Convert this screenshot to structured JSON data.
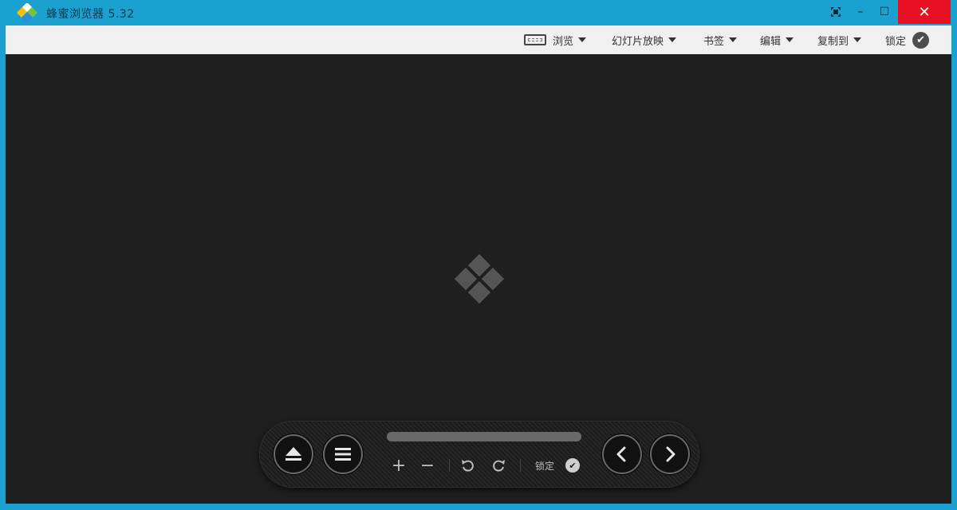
{
  "app": {
    "title": "蜂蜜浏览器 5.32",
    "accent_color": "#1ba1d0"
  },
  "window_controls": {
    "fullscreen_icon": "fullscreen-icon",
    "minimize_icon": "minimize-icon",
    "maximize_icon": "maximize-icon",
    "close_icon": "close-icon",
    "minimize_glyph": "–",
    "maximize_glyph": "☐",
    "close_glyph": "✕"
  },
  "menu": {
    "items": [
      {
        "label": "浏览",
        "has_dropdown": true,
        "icon": "browse-frame-icon"
      },
      {
        "label": "幻灯片放映",
        "has_dropdown": true
      },
      {
        "label": "书签",
        "has_dropdown": true
      },
      {
        "label": "编辑",
        "has_dropdown": true
      },
      {
        "label": "复制到",
        "has_dropdown": true
      },
      {
        "label": "锁定",
        "has_dropdown": false,
        "icon": "check-circle-icon"
      }
    ]
  },
  "viewer": {
    "background": "#1f1f1f",
    "placeholder_icon": "app-logo-placeholder-icon"
  },
  "controlbar": {
    "eject_icon": "eject-icon",
    "menu_icon": "list-menu-icon",
    "zoom_in_glyph": "+",
    "zoom_out_glyph": "−",
    "rotate_left_icon": "rotate-left-icon",
    "rotate_right_icon": "rotate-right-icon",
    "lock_label": "锁定",
    "lock_check_glyph": "✔",
    "prev_icon": "chevron-left-icon",
    "next_icon": "chevron-right-icon",
    "progress": 1.0
  }
}
